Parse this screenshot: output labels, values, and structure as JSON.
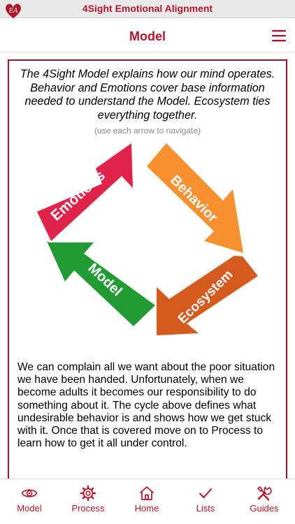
{
  "app": {
    "title": "4Sight Emotional Alignment",
    "logo_monogram": "EA"
  },
  "header": {
    "title": "Model"
  },
  "content": {
    "intro": "The 4Sight Model explains how our mind operates. Behavior and Emotions cover base information needed to understand the Model. Ecosystem ties everything together.",
    "hint": "(use each arrow to navigate)",
    "arrows": [
      {
        "label": "Emotions",
        "color": "#e0234a"
      },
      {
        "label": "Behavior",
        "color": "#f7902e"
      },
      {
        "label": "Ecosystem",
        "color": "#d45a1e"
      },
      {
        "label": "Model",
        "color": "#239b34"
      }
    ],
    "body": "We can complain all we want about the poor situation we have been handed. Unfortunately, when we become adults it becomes our responsibility to do something about it. The cycle above defines what undesirable behavior is and shows how we get stuck with it. Once that is covered move on to Process to learn how to get it all under control."
  },
  "tabs": [
    {
      "label": "Model",
      "icon": "eye-icon"
    },
    {
      "label": "Process",
      "icon": "gear-icon"
    },
    {
      "label": "Home",
      "icon": "home-icon"
    },
    {
      "label": "Lists",
      "icon": "checkmark-icon"
    },
    {
      "label": "Guides",
      "icon": "tools-icon"
    }
  ],
  "colors": {
    "accent": "#b0152a"
  }
}
